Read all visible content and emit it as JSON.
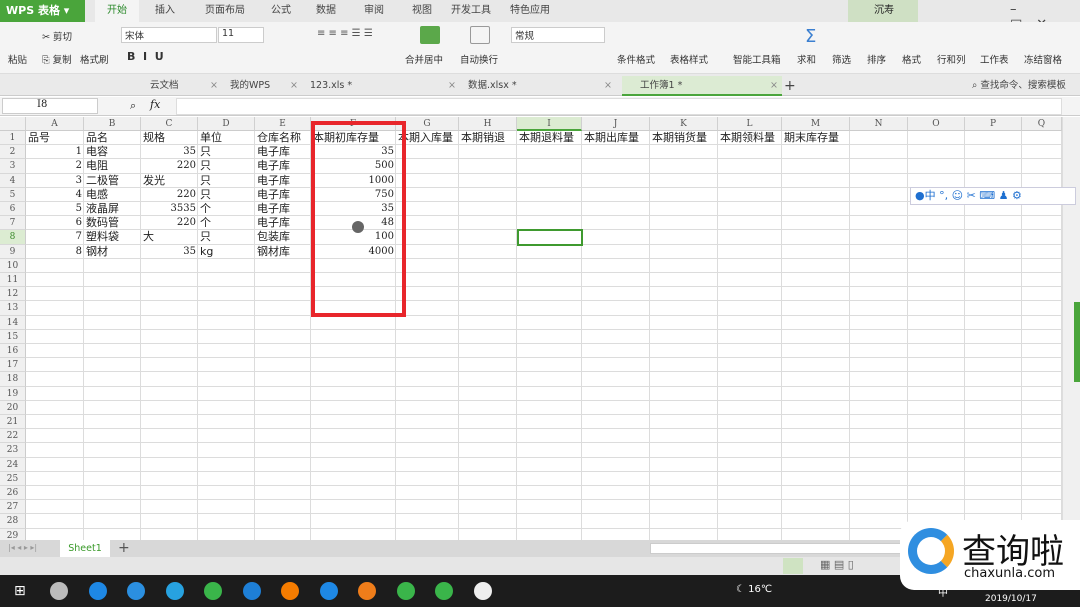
{
  "app": {
    "logo": "WPS 表格",
    "user": "沉寿"
  },
  "menu_tabs": [
    "开始",
    "插入",
    "页面布局",
    "公式",
    "数据",
    "审阅",
    "视图",
    "开发工具",
    "特色应用"
  ],
  "active_tab": "开始",
  "ribbon": {
    "paste": "粘贴",
    "cut": "剪切",
    "copy": "复制",
    "format_painter": "格式刷",
    "font": "宋体",
    "font_size": "11",
    "merge_center": "合并居中",
    "wrap": "自动换行",
    "number_format": "常规",
    "cond_format": "条件格式",
    "table_style": "表格样式",
    "toolbox": "智能工具箱",
    "sum": "求和",
    "filter": "筛选",
    "sort": "排序",
    "format": "格式",
    "row_col": "行和列",
    "worksheet": "工作表",
    "freeze": "冻结窗格"
  },
  "doc_tabs": [
    {
      "label": "云文档"
    },
    {
      "label": "我的WPS"
    },
    {
      "label": "123.xls *"
    },
    {
      "label": "数据.xlsx *"
    },
    {
      "label": "工作簿1 *",
      "active": true
    }
  ],
  "search_placeholder": "查找命令、搜索模板",
  "name_box": "I8",
  "fx": "fx",
  "columns": [
    "A",
    "B",
    "C",
    "D",
    "E",
    "F",
    "G",
    "H",
    "I",
    "J",
    "K",
    "L",
    "M",
    "N",
    "O",
    "P",
    "Q"
  ],
  "headers": [
    "品号",
    "品名",
    "规格",
    "单位",
    "仓库名称",
    "本期初库存量",
    "本期入库量",
    "本期销退",
    "本期退料量",
    "本期出库量",
    "本期销货量",
    "本期领料量",
    "期末库存量"
  ],
  "rows": [
    [
      "1",
      "电容",
      "35",
      "只",
      "电子库",
      "35"
    ],
    [
      "2",
      "电阻",
      "220",
      "只",
      "电子库",
      "500"
    ],
    [
      "3",
      "二极管",
      "发光",
      "只",
      "电子库",
      "1000"
    ],
    [
      "4",
      "电感",
      "220",
      "只",
      "电子库",
      "750"
    ],
    [
      "5",
      "液晶屏",
      "3535",
      "个",
      "电子库",
      "35"
    ],
    [
      "6",
      "数码管",
      "220",
      "个",
      "电子库",
      "48"
    ],
    [
      "7",
      "塑料袋",
      "大",
      "只",
      "包装库",
      "100"
    ],
    [
      "8",
      "钢材",
      "35",
      "kg",
      "钢材库",
      "4000"
    ]
  ],
  "row_count": 29,
  "selected_cell": "I8",
  "highlight_color": "#e8262b",
  "accent": "#4aa53b",
  "sheet_tabs": [
    "Sheet1"
  ],
  "taskbar": {
    "weather": "16℃",
    "ime": "中",
    "date": "2019/10/17"
  },
  "watermark": {
    "text": "查询啦",
    "url": "chaxunla.com"
  }
}
